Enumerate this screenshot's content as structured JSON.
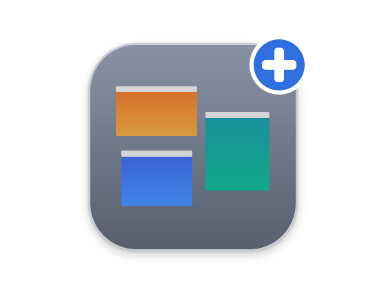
{
  "app_icon": {
    "icon": "app-windows-icon",
    "colors": {
      "background_top": "#8a93a5",
      "background_bottom": "#575e6c",
      "border": "#c9ccd2",
      "title_bar": "#d4d4d6",
      "window_orange_top": "#d46c2c",
      "window_orange_bottom": "#d99a3c",
      "window_blue_top": "#3b5fd4",
      "window_blue_bottom": "#3e84e6",
      "window_teal_top": "#1b8e9e",
      "window_teal_bottom": "#11a888"
    }
  },
  "add_badge": {
    "icon": "plus-icon",
    "colors": {
      "circle": "#2f6fe0",
      "ring": "#ffffff",
      "plus": "#ffffff"
    }
  }
}
